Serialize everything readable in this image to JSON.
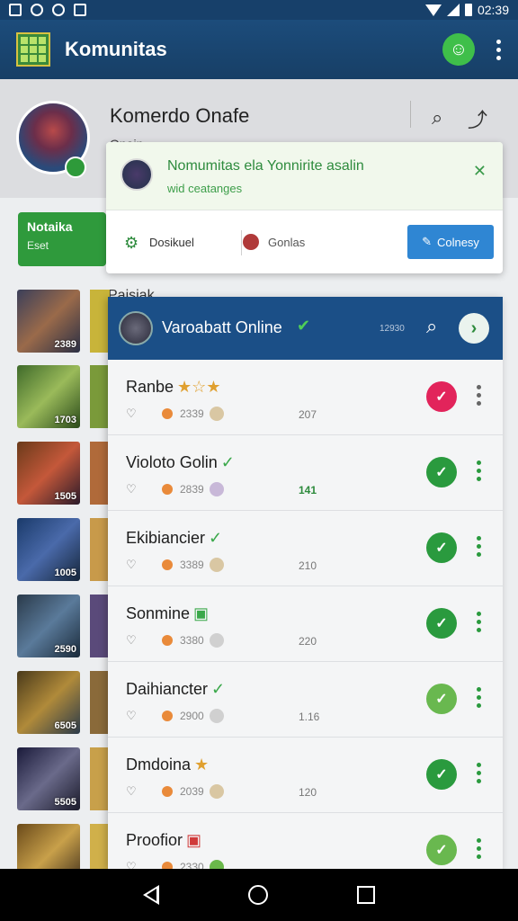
{
  "status_bar": {
    "time": "02:39"
  },
  "app_bar": {
    "title": "Komunitas"
  },
  "profile": {
    "name": "Komerdo Onafe",
    "subtitle": "Onain"
  },
  "left_panel": {
    "green_button": {
      "label": "Notaika",
      "sub": "Eset"
    },
    "label": "Paisiak",
    "thumb_numbers": [
      "2389",
      "1703",
      "1505",
      "1005",
      "2590",
      "6505",
      "5505",
      ""
    ]
  },
  "notification": {
    "title": "Nomumitas ela Yonnirite asalin",
    "subtitle": "wid ceatanges",
    "item1_label": "Dosikuel",
    "item2_label": "Gonlas",
    "action_label": "Colnesy"
  },
  "panel": {
    "title": "Varoabatt Online",
    "meta": "12930",
    "rows": [
      {
        "name": "Ranbe",
        "badge": "★☆★",
        "score": "2339",
        "count": "207",
        "count_green": false,
        "status": "warn"
      },
      {
        "name": "Violoto Golin",
        "badge": "✓",
        "score": "2839",
        "count": "141",
        "count_green": true,
        "status": "ok"
      },
      {
        "name": "Ekibiancier",
        "badge": "✓",
        "score": "3389",
        "count": "210",
        "count_green": false,
        "status": "ok"
      },
      {
        "name": "Sonmine",
        "badge": "▣",
        "score": "3380",
        "count": "220",
        "count_green": false,
        "status": "ok"
      },
      {
        "name": "Daihiancter",
        "badge": "✓",
        "score": "2900",
        "count": "1.16",
        "count_green": false,
        "status": "ok-light"
      },
      {
        "name": "Dmdoina",
        "badge": "★",
        "score": "2039",
        "count": "120",
        "count_green": false,
        "status": "ok"
      },
      {
        "name": "Proofior",
        "badge": "▣",
        "score": "2330",
        "count": "",
        "count_green": false,
        "status": "ok-light"
      }
    ]
  },
  "icons": {
    "chat": "chat-icon",
    "more": "more-vert-icon",
    "search": "search-icon",
    "share": "share-icon",
    "close": "close-icon",
    "heart": "heart-icon",
    "check": "check-icon",
    "back": "back-nav-icon",
    "home": "home-nav-icon",
    "recent": "recents-nav-icon"
  },
  "colors": {
    "appbar": "#1c4c7b",
    "accent_green": "#2a9a3e",
    "accent_blue": "#2f86d3",
    "warn": "#e2245b"
  }
}
